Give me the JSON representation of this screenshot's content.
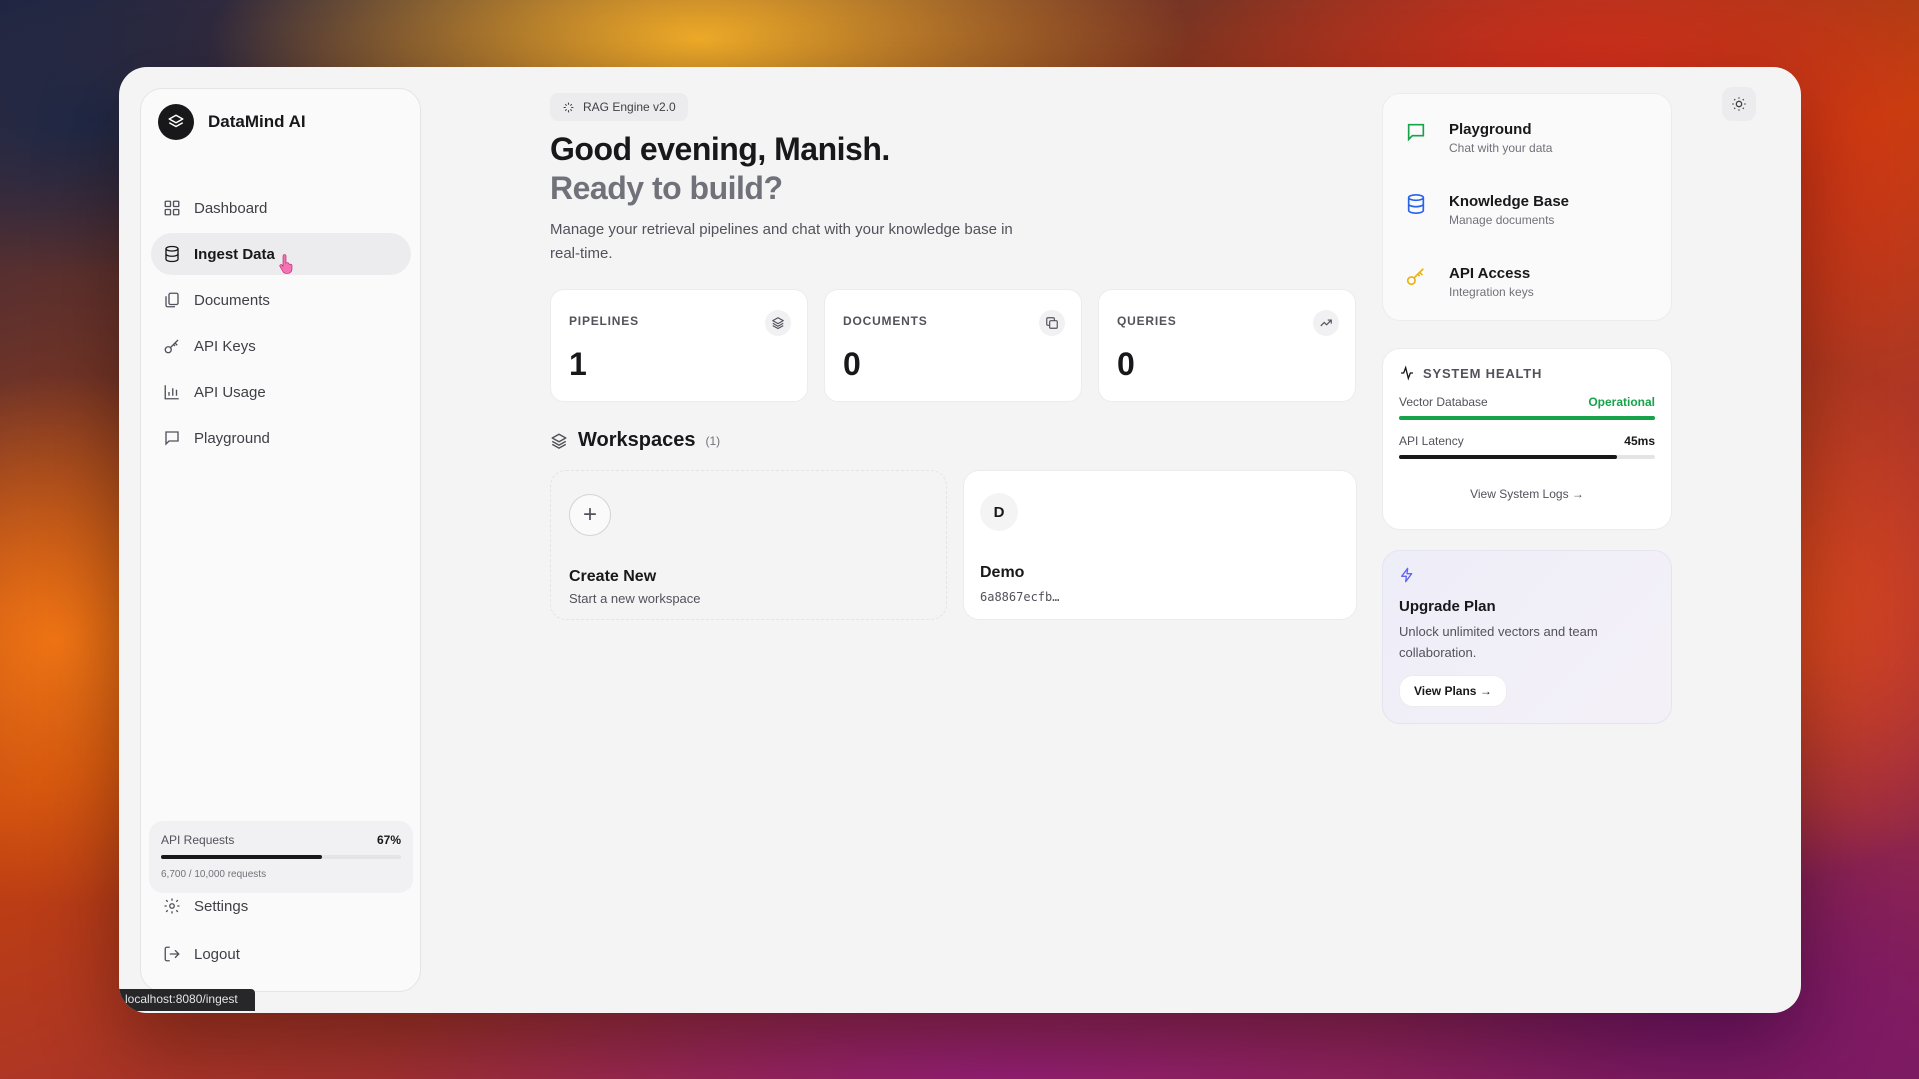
{
  "brand": {
    "name": "DataMind AI"
  },
  "nav": [
    {
      "label": "Dashboard",
      "icon": "dashboard-icon"
    },
    {
      "label": "Ingest Data",
      "icon": "database-icon",
      "active": true
    },
    {
      "label": "Documents",
      "icon": "documents-icon"
    },
    {
      "label": "API Keys",
      "icon": "key-icon"
    },
    {
      "label": "API Usage",
      "icon": "bar-chart-icon"
    },
    {
      "label": "Playground",
      "icon": "chat-icon"
    }
  ],
  "usage": {
    "label": "API Requests",
    "percent_label": "67%",
    "percent": 0.67,
    "detail": "6,700 / 10,000 requests"
  },
  "bottom_nav": [
    {
      "label": "Settings",
      "icon": "gear-icon"
    },
    {
      "label": "Logout",
      "icon": "logout-icon"
    }
  ],
  "status_url": "localhost:8080/ingest",
  "header": {
    "badge": "RAG Engine v2.0",
    "greeting": "Good evening, Manish.",
    "subgreeting": "Ready to build?",
    "description": "Manage your retrieval pipelines and chat with your knowledge base in real-time."
  },
  "stats": [
    {
      "label": "PIPELINES",
      "value": "1",
      "icon": "layers-icon"
    },
    {
      "label": "DOCUMENTS",
      "value": "0",
      "icon": "copy-icon"
    },
    {
      "label": "QUERIES",
      "value": "0",
      "icon": "trending-up-icon"
    }
  ],
  "workspaces": {
    "title": "Workspaces",
    "count": "(1)",
    "create": {
      "title": "Create New",
      "subtitle": "Start a new workspace"
    },
    "items": [
      {
        "initial": "D",
        "name": "Demo",
        "id": "6a8867ecfb…"
      }
    ]
  },
  "quick_links": [
    {
      "title": "Playground",
      "subtitle": "Chat with your data",
      "icon": "chat-icon",
      "color": "#16a34a"
    },
    {
      "title": "Knowledge Base",
      "subtitle": "Manage documents",
      "icon": "database-icon",
      "color": "#2563eb"
    },
    {
      "title": "API Access",
      "subtitle": "Integration keys",
      "icon": "key-icon",
      "color": "#eab308"
    }
  ],
  "health": {
    "title": "SYSTEM HEALTH",
    "vector_db": {
      "label": "Vector Database",
      "status": "Operational",
      "level": 1.0,
      "color": "#16a34a"
    },
    "latency": {
      "label": "API Latency",
      "value": "45ms",
      "level": 0.85,
      "color": "#18181b"
    },
    "link": "View System Logs →"
  },
  "upgrade": {
    "title": "Upgrade Plan",
    "description": "Unlock unlimited vectors and team collaboration.",
    "button": "View Plans →",
    "icon_color": "#6366f1"
  }
}
